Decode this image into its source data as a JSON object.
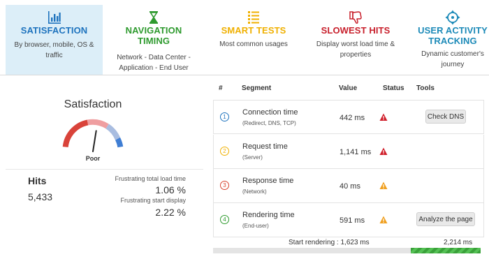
{
  "tabs": [
    {
      "title": "SATISFACTION",
      "desc": "By browser, mobile, OS & traffic",
      "icon": "bar-chart-icon",
      "color": "#1e73be",
      "active": true
    },
    {
      "title": "NAVIGATION TIMING",
      "desc": "Network - Data Center - Application - End User",
      "icon": "hourglass-icon",
      "color": "#2e9a2e",
      "active": false
    },
    {
      "title": "SMART TESTS",
      "desc": "Most common usages",
      "icon": "checklist-icon",
      "color": "#f0b000",
      "active": false
    },
    {
      "title": "SLOWEST HITS",
      "desc": "Display worst load time & properties",
      "icon": "thumbs-down-icon",
      "color": "#c8202c",
      "active": false
    },
    {
      "title": "USER ACTIVITY TRACKING",
      "desc": "Dynamic customer's journey",
      "icon": "crosshair-icon",
      "color": "#1c8ab8",
      "active": false
    }
  ],
  "satisfaction": {
    "title": "Satisfaction",
    "gauge_label": "Poor",
    "gauge_level": 0.55,
    "hits_label": "Hits",
    "hits_value": "5,433",
    "frustrating_load_label": "Frustrating total load time",
    "frustrating_load_value": "1.06 %",
    "frustrating_start_label": "Frustrating start display",
    "frustrating_start_value": "2.22 %"
  },
  "table": {
    "headers": {
      "num": "#",
      "segment": "Segment",
      "value": "Value",
      "status": "Status",
      "tools": "Tools"
    },
    "rows": [
      {
        "num": "1",
        "segment": "Connection time",
        "sub": "(Redirect, DNS, TCP)",
        "value": "442 ms",
        "status": "critical",
        "tool": "Check DNS",
        "num_color": "#1e73be"
      },
      {
        "num": "2",
        "segment": "Request time",
        "sub": "(Server)",
        "value": "1,141 ms",
        "status": "critical",
        "tool": "",
        "num_color": "#f0b000"
      },
      {
        "num": "3",
        "segment": "Response time",
        "sub": "(Network)",
        "value": "40 ms",
        "status": "warning",
        "tool": "",
        "num_color": "#d9442f"
      },
      {
        "num": "4",
        "segment": "Rendering time",
        "sub": "(End-user)",
        "value": "591 ms",
        "status": "warning",
        "tool": "Analyze the page",
        "num_color": "#2e9a2e"
      }
    ],
    "start_rendering_label": "Start rendering : 1,623 ms",
    "end_label": "2,214 ms",
    "start_rendering_fraction": 0.733
  },
  "colors": {
    "critical": "#d0202c",
    "warning": "#f0a020",
    "active_tab_bg": "#dceef8"
  }
}
